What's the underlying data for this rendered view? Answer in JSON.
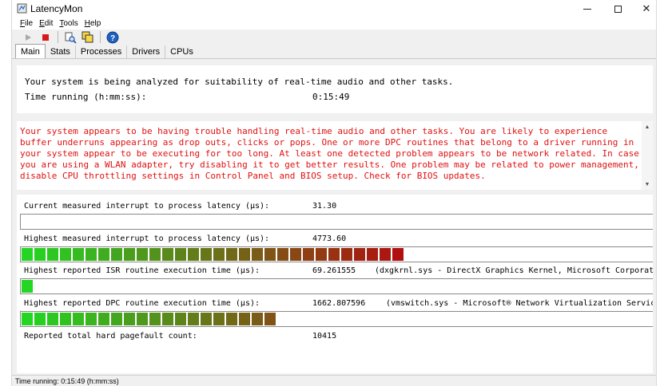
{
  "window": {
    "title": "LatencyMon",
    "controls": {
      "minimize": "minimize",
      "maximize": "maximize",
      "close": "✕"
    }
  },
  "menu": {
    "items": [
      {
        "label": "File",
        "accel": "F",
        "rest": "ile"
      },
      {
        "label": "Edit",
        "accel": "E",
        "rest": "dit"
      },
      {
        "label": "Tools",
        "accel": "T",
        "rest": "ools"
      },
      {
        "label": "Help",
        "accel": "H",
        "rest": "elp"
      }
    ]
  },
  "toolbar": {
    "buttons": [
      "play-icon",
      "stop-icon",
      "analyze-icon",
      "copy-icon",
      "help-icon"
    ]
  },
  "tabs": [
    {
      "label": "Main",
      "active": true
    },
    {
      "label": "Stats",
      "active": false
    },
    {
      "label": "Processes",
      "active": false
    },
    {
      "label": "Drivers",
      "active": false
    },
    {
      "label": "CPUs",
      "active": false
    }
  ],
  "top_panel": {
    "analysis_msg": "Your system is being analyzed for suitability of real-time audio and other tasks.",
    "time_label": "Time running (h:mm:ss):",
    "time_value": "0:15:49"
  },
  "warning": {
    "text": "Your system appears to be having trouble handling real-time audio and other tasks. You are likely to experience buffer underruns appearing as drop outs, clicks or pops. One or more DPC routines that belong to a driver running in your system appear to be executing for too long. At least one detected problem appears to be network related. In case you are using a WLAN adapter, try disabling it to get better results. One problem may be related to power management, disable CPU throttling settings in Control Panel and BIOS setup. Check for BIOS updates."
  },
  "metrics": {
    "current_latency": {
      "label": "Current measured interrupt to process latency (µs):",
      "value": "31.30",
      "segments": 0
    },
    "highest_latency": {
      "label": "Highest measured interrupt to process latency (µs):",
      "value": "4773.60",
      "segments": 30
    },
    "highest_isr": {
      "label": "Highest reported ISR routine execution time (µs):",
      "value": "69.261555",
      "extra": "(dxgkrnl.sys - DirectX Graphics Kernel, Microsoft Corporation)",
      "segments": 1
    },
    "highest_dpc": {
      "label": "Highest reported DPC routine execution time (µs):",
      "value": "1662.807596",
      "extra": "(vmswitch.sys - Microsoft® Network Virtualization Service)",
      "segments": 20
    },
    "pagefault": {
      "label": "Reported total hard pagefault count:",
      "value": "10415"
    }
  },
  "status": {
    "text": "Time running: 0:15:49  (h:mm:ss)"
  },
  "colors": {
    "warning_text": "#e01010",
    "bar_start": "#22d622",
    "bar_end": "#b01010"
  }
}
